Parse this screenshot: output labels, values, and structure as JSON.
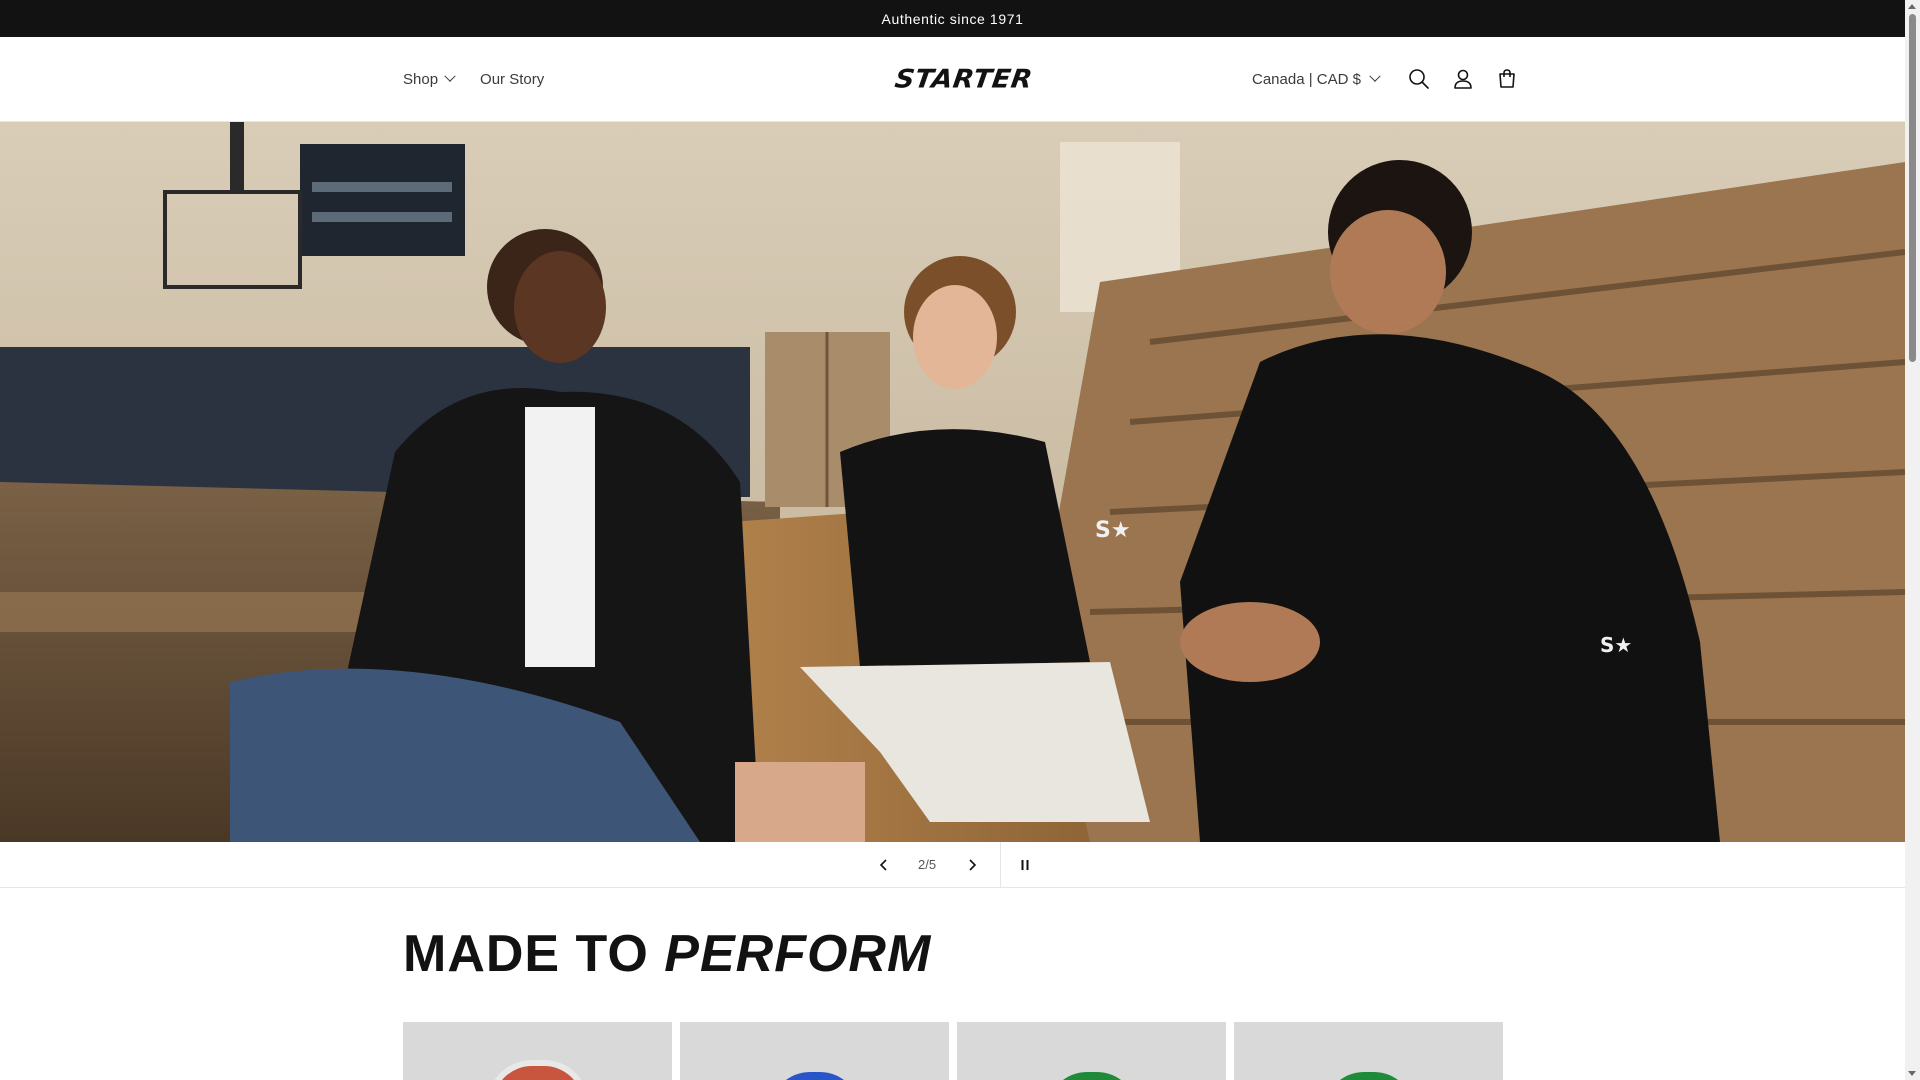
{
  "announcement": {
    "text": "Authentic since 1971"
  },
  "header": {
    "nav": [
      {
        "label": "Shop",
        "has_dropdown": true
      },
      {
        "label": "Our Story",
        "has_dropdown": false
      }
    ],
    "logo_text": "STARTER",
    "country_selector": "Canada | CAD $",
    "icons": [
      "search-icon",
      "account-icon",
      "cart-icon"
    ]
  },
  "slideshow": {
    "current": "2",
    "total": "5",
    "counter_separator": "/",
    "controls": [
      "chevron-left-icon",
      "chevron-right-icon",
      "pause-icon"
    ]
  },
  "section": {
    "heading_plain": "MADE TO",
    "heading_italic": "PERFORM"
  },
  "products": {
    "count": 4,
    "accent_colors": [
      "#c8553d",
      "#2a55c9",
      "#1f8a3a",
      "#1f8a3a"
    ]
  },
  "colors": {
    "announcement_bg": "#121212",
    "text": "#121212",
    "product_card_bg": "#d9d9d9"
  }
}
